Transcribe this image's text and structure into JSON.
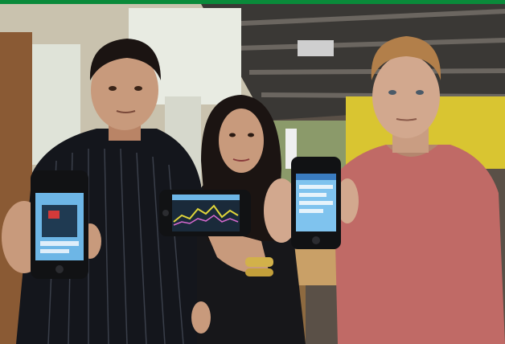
{
  "photo": {
    "description_icon": "photo-icon"
  },
  "colors": {
    "top_border": "#0a8a3a",
    "ceiling": "#3a3835",
    "wall_left": "#c9c2ae",
    "window": "#dfe3d8",
    "yellow_wall": "#d9c531",
    "table": "#c9a067",
    "shirt_left": "#14161c",
    "shirt_right": "#c06a66",
    "skin": "#c89a7c",
    "hair_dark": "#1b1412",
    "hair_blond": "#b27f4a",
    "phone_body": "#111214",
    "screen_blue": "#6db6e6"
  }
}
